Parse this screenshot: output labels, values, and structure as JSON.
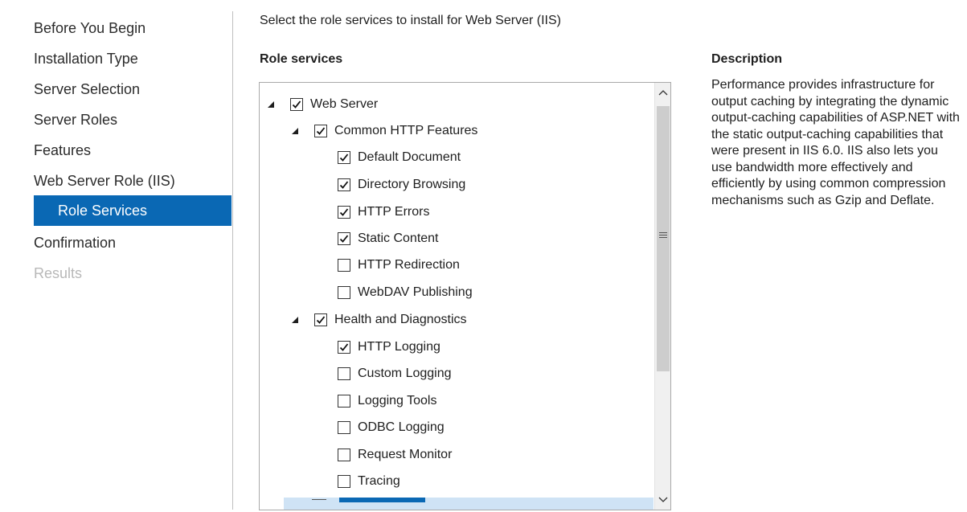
{
  "nav": {
    "items": [
      {
        "label": "Before You Begin"
      },
      {
        "label": "Installation Type"
      },
      {
        "label": "Server Selection"
      },
      {
        "label": "Server Roles"
      },
      {
        "label": "Features"
      },
      {
        "label": "Web Server Role (IIS)"
      },
      {
        "label": "Role Services"
      },
      {
        "label": "Confirmation"
      },
      {
        "label": "Results"
      }
    ],
    "accent_color": "#0a68b4"
  },
  "main": {
    "heading": "Select the role services to install for Web Server (IIS)",
    "role_services_label": "Role services",
    "description_label": "Description",
    "description_text": "Performance provides infrastructure for output caching by integrating the dynamic output-caching capabilities of ASP.NET with the static output-caching capabilities that were present in IIS 6.0. IIS also lets you use bandwidth more effectively and efficiently by using common compression mechanisms such as Gzip and Deflate."
  },
  "tree": [
    {
      "label": "Web Server",
      "checked": true,
      "expanded": true
    },
    {
      "label": "Common HTTP Features",
      "checked": true,
      "expanded": true
    },
    {
      "label": "Default Document",
      "checked": true
    },
    {
      "label": "Directory Browsing",
      "checked": true
    },
    {
      "label": "HTTP Errors",
      "checked": true
    },
    {
      "label": "Static Content",
      "checked": true
    },
    {
      "label": "HTTP Redirection",
      "checked": false
    },
    {
      "label": "WebDAV Publishing",
      "checked": false
    },
    {
      "label": "Health and Diagnostics",
      "checked": true,
      "expanded": true
    },
    {
      "label": "HTTP Logging",
      "checked": true
    },
    {
      "label": "Custom Logging",
      "checked": false
    },
    {
      "label": "Logging Tools",
      "checked": false
    },
    {
      "label": "ODBC Logging",
      "checked": false
    },
    {
      "label": "Request Monitor",
      "checked": false
    },
    {
      "label": "Tracing",
      "checked": false
    }
  ],
  "icons": {
    "expanded": "triangle-down-icon",
    "check": "check-icon",
    "scroll_up": "chevron-up-icon",
    "scroll_down": "chevron-down-icon",
    "grip": "scroll-grip-icon"
  }
}
